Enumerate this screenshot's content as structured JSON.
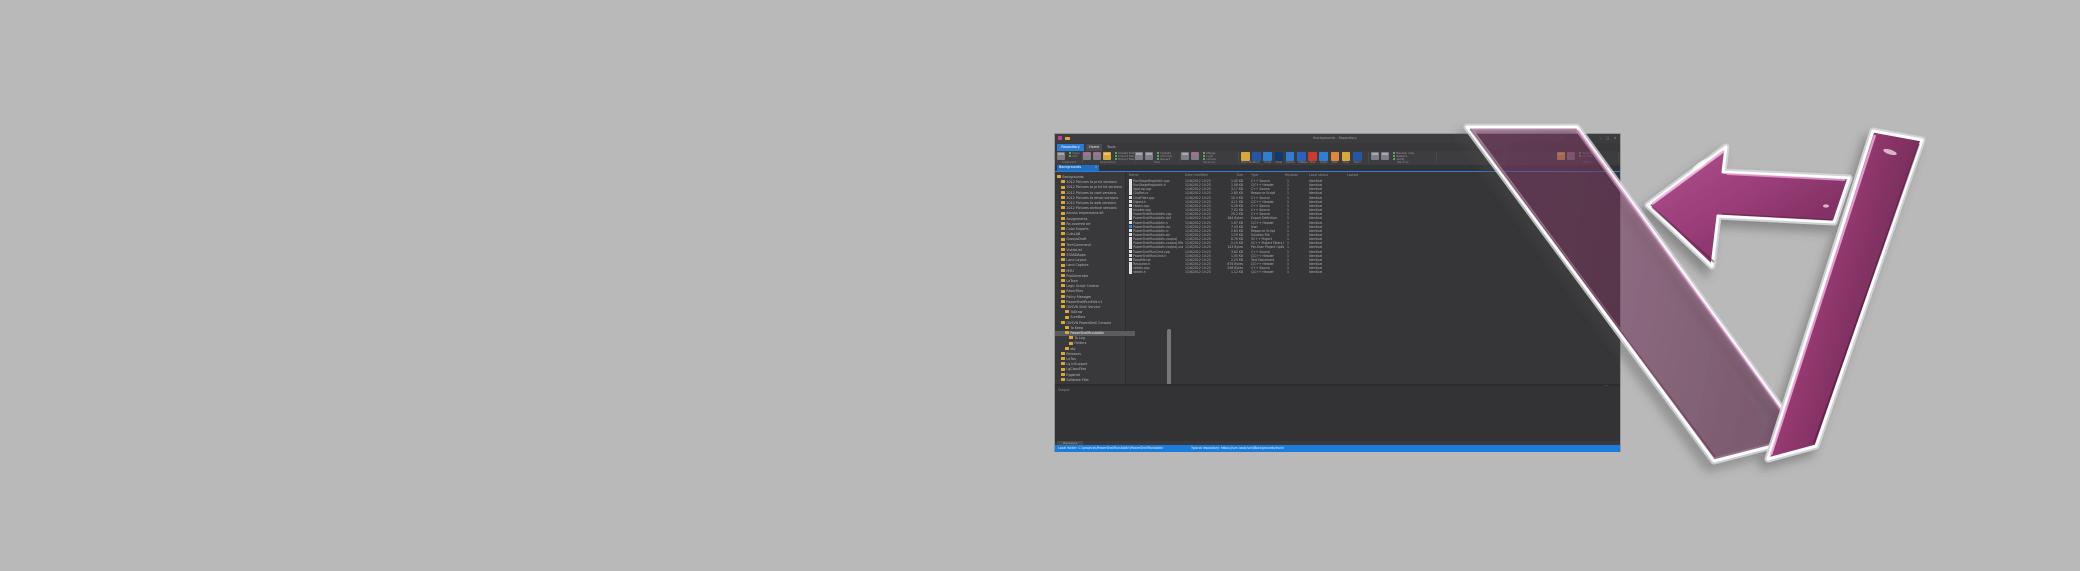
{
  "window": {
    "title": "Backgrounds - Repository",
    "titlebar_buttons": "– □ ×",
    "ribbon": {
      "app_button": "Repository",
      "tabs": [
        {
          "label": "Home",
          "active": true
        },
        {
          "label": "Tools",
          "active": false
        }
      ],
      "groups": [
        {
          "label": "Clipboard",
          "bigs": [
            "paste"
          ],
          "smalls": [
            "Copy",
            "Cut"
          ]
        },
        {
          "label": "Repository",
          "bigs": [
            "mag",
            "mag",
            "fold"
          ],
          "smalls": [
            "Create folder",
            "Import files",
            "Export files"
          ]
        },
        {
          "label": "Files",
          "bigs": [
            "plain",
            "plain"
          ],
          "smalls": [
            "Update",
            "Commit",
            "Revert"
          ]
        },
        {
          "label": "Versions",
          "bigs": [
            "plain",
            "mag"
          ],
          "smalls": [
            "Merge",
            "Lock",
            "Unlock"
          ]
        },
        {
          "label": "Tools",
          "bigs": [],
          "smalls": []
        },
        {
          "label": "Backup",
          "bigs": [
            "plain",
            "plain"
          ],
          "smalls": [
            "Backup now",
            "Restore",
            "Verify"
          ]
        },
        {
          "label": "Style",
          "bigs": [
            "fold",
            "mag"
          ],
          "smalls": [
            "Theme",
            "Accent"
          ]
        }
      ],
      "apps": [
        {
          "label": "PowerShell",
          "color": "#d8a83e"
        },
        {
          "label": "Cmd",
          "color": "#2456a8"
        },
        {
          "label": "Code",
          "color": "#2e7fd4"
        },
        {
          "label": "Shell",
          "color": "#0f3a70"
        },
        {
          "label": "Deploy",
          "color": "#2e7fd4"
        },
        {
          "label": "Docs",
          "color": "#2a62c2"
        },
        {
          "label": "Stop",
          "color": "#cc3b30"
        },
        {
          "label": "Audio",
          "color": "#2e7fd4"
        },
        {
          "label": "Web",
          "color": "#e08838"
        },
        {
          "label": "Files",
          "color": "#d8a83e"
        },
        {
          "label": "Build",
          "color": "#2456a8"
        }
      ]
    },
    "tabbar": {
      "active_tab": "Backgrounds",
      "close_glyph": "×"
    },
    "tree": [
      {
        "level": 0,
        "name": "Backgrounds"
      },
      {
        "level": 1,
        "name": "2012 Pictures to print versions"
      },
      {
        "level": 1,
        "name": "2012 Pictures to print kit versions"
      },
      {
        "level": 1,
        "name": "2012 Pictures to card versions"
      },
      {
        "level": 1,
        "name": "2012 Pictures to email versions"
      },
      {
        "level": 1,
        "name": "2012 Pictures to web versions"
      },
      {
        "level": 1,
        "name": "2012 Pictures archive versions"
      },
      {
        "level": 1,
        "name": "Access impressions kit"
      },
      {
        "level": 1,
        "name": "Assignments"
      },
      {
        "level": 1,
        "name": "Re-covered art"
      },
      {
        "level": 1,
        "name": "Color Exports"
      },
      {
        "level": 1,
        "name": "CutsLAB"
      },
      {
        "level": 1,
        "name": "GroupsDraft"
      },
      {
        "level": 1,
        "name": "TechCommand"
      },
      {
        "level": 1,
        "name": "VividsList"
      },
      {
        "level": 1,
        "name": "STANDApps"
      },
      {
        "level": 1,
        "name": "Land Layout"
      },
      {
        "level": 1,
        "name": "Land Capture"
      },
      {
        "level": 1,
        "name": "MSU"
      },
      {
        "level": 1,
        "name": "RipGenerator"
      },
      {
        "level": 1,
        "name": "LaToon"
      },
      {
        "level": 1,
        "name": "Logic Script Creator"
      },
      {
        "level": 1,
        "name": "RacerFiles"
      },
      {
        "level": 1,
        "name": "Policy Manager"
      },
      {
        "level": 1,
        "name": "PowerShellRunEdit.v1"
      },
      {
        "level": 1,
        "name": "QVSVN Shell Service"
      },
      {
        "level": 2,
        "name": "ToDraw"
      },
      {
        "level": 2,
        "name": "SureBars"
      },
      {
        "level": 1,
        "name": "QVSVN PowerShell Console"
      },
      {
        "level": 2,
        "name": "To Keep"
      },
      {
        "level": 2,
        "name": "PowerShellRunAddIn",
        "selected": true
      },
      {
        "level": 3,
        "name": "To Log"
      },
      {
        "level": 3,
        "name": "Folders"
      },
      {
        "level": 2,
        "name": "obj"
      },
      {
        "level": 1,
        "name": "Releases"
      },
      {
        "level": 1,
        "name": "LaTan"
      },
      {
        "level": 1,
        "name": "Lg InSupport"
      },
      {
        "level": 1,
        "name": "LgClassFiles"
      },
      {
        "level": 1,
        "name": "Eggshell"
      },
      {
        "level": 1,
        "name": "Software Filer"
      }
    ],
    "columns": [
      "Name",
      "Date modified",
      "Size",
      "Type",
      "Revision",
      "Local status",
      "Locked"
    ],
    "files": [
      {
        "name": "RunStageRegAddIn.cpp",
        "date": "1/16/2012 10:23 PM",
        "size": "1.45 KB",
        "type": "C++ Source",
        "rev": "1",
        "status": "Identical"
      },
      {
        "name": "RunStageRegAddIn.h",
        "date": "1/16/2012 10:23 PM",
        "size": "1.08 KB",
        "type": "C/C++ Header",
        "rev": "1",
        "status": "Identical"
      },
      {
        "name": "AppLog.cpp",
        "date": "1/16/2012 10:23 PM",
        "size": "3.17 KB",
        "type": "C++ Source",
        "rev": "1",
        "status": "Identical"
      },
      {
        "name": "ClipRes.rc",
        "date": "1/16/2012 10:23 PM",
        "size": "2.85 KB",
        "type": "Resource Script",
        "rev": "1",
        "status": "Identical"
      },
      {
        "name": "CmdFilter.cpp",
        "date": "1/16/2012 10:23 PM",
        "size": "10.3 KB",
        "type": "C++ Source",
        "rev": "1",
        "status": "Identical"
      },
      {
        "name": "Digest.h",
        "date": "1/16/2012 10:23 PM",
        "size": "4.11 KB",
        "type": "C/C++ Header",
        "rev": "1",
        "status": "Identical"
      },
      {
        "name": "Hooks.cpp",
        "date": "1/16/2012 10:23 PM",
        "size": "5.26 KB",
        "type": "C++ Source",
        "rev": "1",
        "status": "Identical"
      },
      {
        "name": "Invoker.cpp",
        "date": "1/16/2012 10:23 PM",
        "size": "7.02 KB",
        "type": "C++ Source",
        "rev": "1",
        "status": "Identical"
      },
      {
        "name": "PowerShellRunAddIn.cpp",
        "date": "1/16/2012 10:23 PM",
        "size": "29.2 KB",
        "type": "C++ Source",
        "rev": "1",
        "status": "Identical"
      },
      {
        "name": "PowerShellRunAddIn.def",
        "date": "1/16/2012 10:23 PM",
        "size": "184 Bytes",
        "type": "Export Definition",
        "rev": "1",
        "status": "Identical"
      },
      {
        "name": "PowerShellRunAddIn.h",
        "date": "1/16/2012 10:23 PM",
        "size": "1.67 KB",
        "type": "C/C++ Header",
        "rev": "1",
        "status": "Identical"
      },
      {
        "name": "PowerShellRunAddIn.ico",
        "date": "1/16/2012 10:23 PM",
        "size": "7.43 KB",
        "type": "Icon",
        "rev": "1",
        "status": "Identical",
        "icon": "blue"
      },
      {
        "name": "PowerShellRunAddIn.rc",
        "date": "1/16/2012 10:23 PM",
        "size": "2.64 KB",
        "type": "Resource Script",
        "rev": "1",
        "status": "Identical"
      },
      {
        "name": "PowerShellRunAddIn.sln",
        "date": "1/16/2012 10:23 PM",
        "size": "1.29 KB",
        "type": "Solution File",
        "rev": "1",
        "status": "Identical"
      },
      {
        "name": "PowerShellRunAddIn.vcxproj",
        "date": "1/16/2012 10:23 PM",
        "size": "8.76 KB",
        "type": "VC++ Project",
        "rev": "1",
        "status": "Identical"
      },
      {
        "name": "PowerShellRunAddIn.vcxproj.filters",
        "date": "1/16/2012 10:23 PM",
        "size": "2.15 KB",
        "type": "VC++ Project Filters File",
        "rev": "1",
        "status": "Identical"
      },
      {
        "name": "PowerShellRunAddIn.vcxproj.user",
        "date": "1/16/2012 10:23 PM",
        "size": "143 Bytes",
        "type": "Per-User Project Options",
        "rev": "1",
        "status": "Identical"
      },
      {
        "name": "PowerShellRunCmd.cpp",
        "date": "1/16/2012 10:23 PM",
        "size": "3.62 KB",
        "type": "C++ Source",
        "rev": "1",
        "status": "Identical"
      },
      {
        "name": "PowerShellRunCmd.h",
        "date": "1/16/2012 10:23 PM",
        "size": "1.05 KB",
        "type": "C/C++ Header",
        "rev": "1",
        "status": "Identical"
      },
      {
        "name": "ReadMe.txt",
        "date": "1/16/2012 10:23 PM",
        "size": "2.23 KB",
        "type": "Text Document",
        "rev": "1",
        "status": "Identical"
      },
      {
        "name": "Resource.h",
        "date": "1/16/2012 10:23 PM",
        "size": "876 Bytes",
        "type": "C/C++ Header",
        "rev": "1",
        "status": "Identical"
      },
      {
        "name": "stdafx.cpp",
        "date": "1/16/2012 10:23 PM",
        "size": "298 Bytes",
        "type": "C++ Source",
        "rev": "1",
        "status": "Identical"
      },
      {
        "name": "stdafx.h",
        "date": "1/16/2012 10:23 PM",
        "size": "1.12 KB",
        "type": "C/C++ Header",
        "rev": "1",
        "status": "Identical"
      }
    ],
    "output_pane": {
      "label": "Output"
    },
    "bottom_tab": "Messages",
    "divider_dots": "⋯",
    "statusbar": {
      "left": "Local folder: C:\\projects\\PowerShellRunAddIn\\PowerShellRunAddIn",
      "mid": "Typical repository: https://svn.local/svn/Backgrounds/trunk"
    }
  },
  "logo": {
    "name": "glossy-arrow-v-logo",
    "fill": "#9a3d78",
    "dark": "#5e2349",
    "light": "#e9a6d4",
    "outline": "#ffffff"
  },
  "colors": {
    "background": "#b9b9b9",
    "accent_blue": "#2e7fd6",
    "statusbar_blue": "#1b7cd9",
    "folder_yellow": "#d8a83e"
  }
}
